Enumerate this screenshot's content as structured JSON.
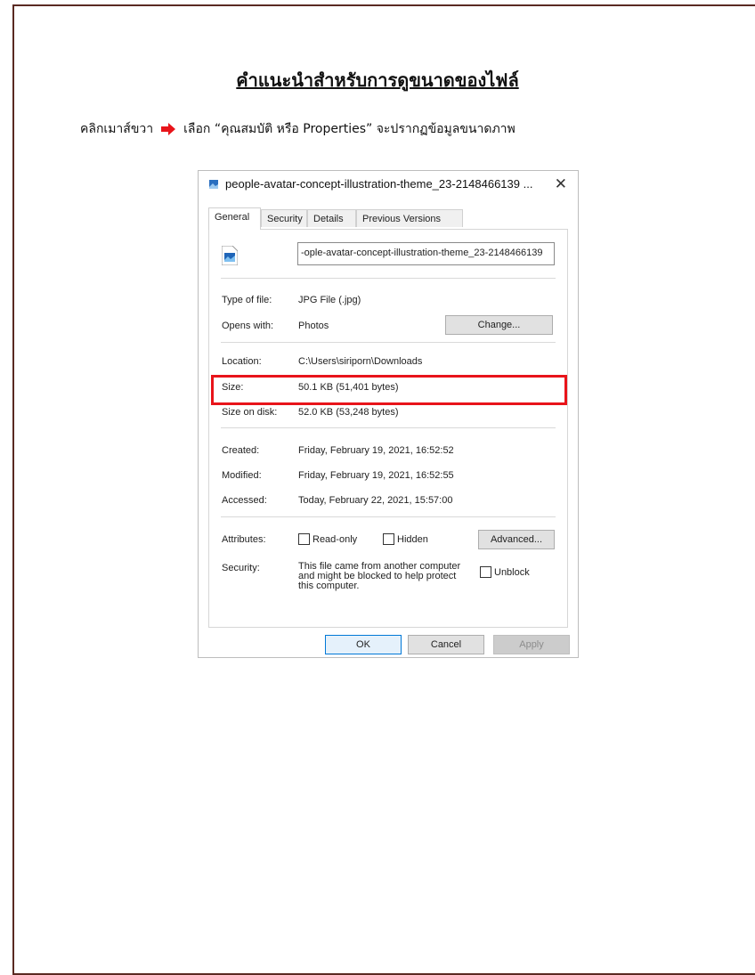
{
  "page": {
    "title": "คำแนะนำสำหรับการดูขนาดของไฟล์",
    "instruction_before": "คลิกเมาส์ขวา",
    "instruction_after": "เลือก “คุณสมบัติ หรือ Properties” จะปรากฏข้อมูลขนาดภาพ",
    "arrow_icon": "right-arrow-icon",
    "arrow_color": "#e8141a",
    "highlight_color": "#e8141a"
  },
  "dialog": {
    "title": "people-avatar-concept-illustration-theme_23-2148466139 ...",
    "close_label": "✕",
    "tabs": [
      "General",
      "Security",
      "Details",
      "Previous Versions"
    ],
    "active_tab": "General",
    "filename": "-ople-avatar-concept-illustration-theme_23-2148466139",
    "rows": {
      "type_label": "Type of file:",
      "type_value": "JPG File (.jpg)",
      "opens_label": "Opens with:",
      "opens_value": "Photos",
      "change_button": "Change...",
      "location_label": "Location:",
      "location_value": "C:\\Users\\siriporn\\Downloads",
      "size_label": "Size:",
      "size_value": "50.1 KB (51,401 bytes)",
      "size_on_disk_label": "Size on disk:",
      "size_on_disk_value": "52.0 KB (53,248 bytes)",
      "created_label": "Created:",
      "created_value": "Friday, February 19, 2021, 16:52:52",
      "modified_label": "Modified:",
      "modified_value": "Friday, February 19, 2021, 16:52:55",
      "accessed_label": "Accessed:",
      "accessed_value": "Today, February 22, 2021, 15:57:00",
      "attributes_label": "Attributes:",
      "readonly_label": "Read-only",
      "hidden_label": "Hidden",
      "advanced_button": "Advanced...",
      "security_label": "Security:",
      "security_line1": "This file came from another computer",
      "security_line2": "and might be blocked to help protect",
      "security_line3": "this computer.",
      "unblock_label": "Unblock"
    },
    "buttons": {
      "ok": "OK",
      "cancel": "Cancel",
      "apply": "Apply"
    }
  }
}
